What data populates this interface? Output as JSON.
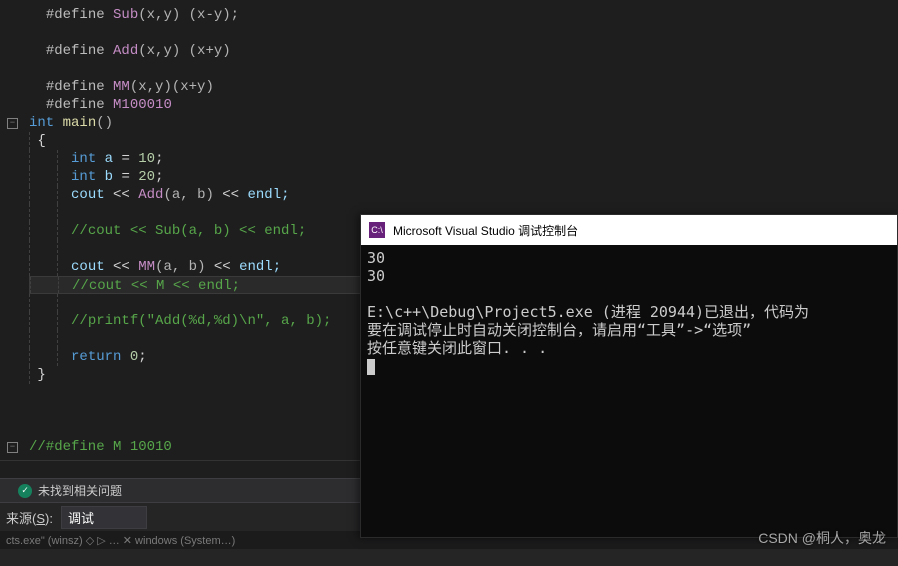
{
  "code": {
    "l1_dir": "#define ",
    "l1_mac": "Sub",
    "l1_params": "(x,y) (x-y);",
    "l2_dir": "#define ",
    "l2_mac": "Add",
    "l2_params": "(x,y) (x+y)",
    "l3_dir": "#define ",
    "l3_mac": "MM",
    "l3_params": "(x,y)(x+y)",
    "l4_dir": "#define ",
    "l4_mac": "M100010",
    "l5_kw": "int",
    "l5_fn": " main",
    "l5_par": "()",
    "l6": "{",
    "l7_kw": "int",
    "l7_var": " a ",
    "l7_eq": "= ",
    "l7_num": "10",
    "l7_sc": ";",
    "l8_kw": "int",
    "l8_var": " b ",
    "l8_eq": "= ",
    "l8_num": "20",
    "l8_sc": ";",
    "l9_a": "cout ",
    "l9_b": "<< ",
    "l9_mac": "Add",
    "l9_c": "(a, b) ",
    "l9_d": "<< ",
    "l9_e": "endl;",
    "l10": "//cout << Sub(a, b) << endl;",
    "l11_a": "cout ",
    "l11_b": "<< ",
    "l11_mac": "MM",
    "l11_c": "(a, b) ",
    "l11_d": "<< ",
    "l11_e": "endl;",
    "l12": "//cout << M << endl;",
    "l13": "//printf(\"Add(%d,%d)\\n\", a, b);",
    "l14_kw": "return",
    "l14_sp": " ",
    "l14_num": "0",
    "l14_sc": ";",
    "l15": "}",
    "l16": "//#define M 10010"
  },
  "status": {
    "icon": "✓",
    "text": "未找到相关问题"
  },
  "panel": {
    "label_pre": "来源(",
    "label_key": "S",
    "label_post": "):",
    "select_value": "调试",
    "lower": "cts.exe\"  (winsz)  ◇  ▷  …  ✕  windows (System…)"
  },
  "console": {
    "icon": "C:\\",
    "title": "Microsoft Visual Studio 调试控制台",
    "out1": "30",
    "out2": "30",
    "msg1": "E:\\c++\\Debug\\Project5.exe (进程 20944)已退出，代码为",
    "msg2": "要在调试停止时自动关闭控制台，请启用“工具”->“选项”",
    "msg3": "按任意键关闭此窗口. . ."
  },
  "watermark": "CSDN @桐人，奥龙"
}
